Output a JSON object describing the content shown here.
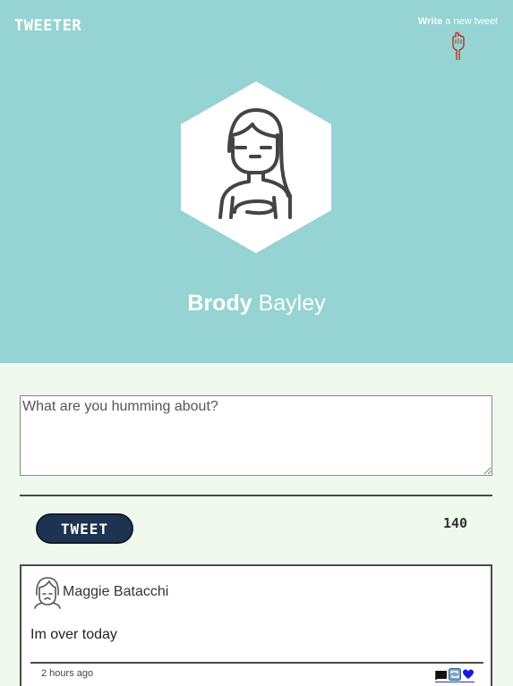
{
  "header": {
    "brand": "TWEETER",
    "compose_bold": "Write",
    "compose_rest": " a new tweet",
    "bg_color": "#96d3d3"
  },
  "profile": {
    "first_name": "Brody",
    "last_name": " Bayley",
    "avatar_icon": "user-avatar-icon"
  },
  "composer": {
    "placeholder": "What are you humming about?",
    "value": "",
    "button_label": "TWEET",
    "char_count": "140",
    "button_color": "#1d3350"
  },
  "tweets": [
    {
      "author": "Maggie Batacchi",
      "text": "Im over today",
      "time": "2 hours ago",
      "actions": [
        "flag-icon",
        "retweet-icon",
        "heart-icon"
      ]
    }
  ],
  "colors": {
    "page_bg": "#f0f9ee",
    "heart": "#1a1adb",
    "pointer": "#c0392b"
  }
}
